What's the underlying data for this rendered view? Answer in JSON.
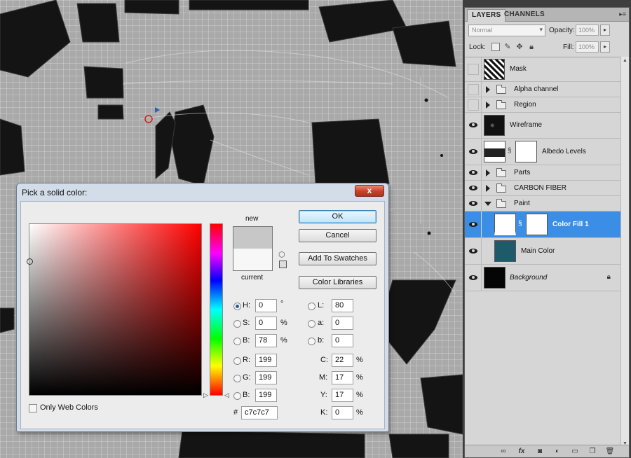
{
  "dialog": {
    "title": "Pick a solid color:",
    "close_label": "x",
    "new_label": "new",
    "current_label": "current",
    "buttons": {
      "ok": "OK",
      "cancel": "Cancel",
      "add_to_swatches": "Add To Swatches",
      "color_libraries": "Color Libraries"
    },
    "fields": {
      "H": {
        "label": "H:",
        "value": "0",
        "unit": "°"
      },
      "S": {
        "label": "S:",
        "value": "0",
        "unit": "%"
      },
      "Bri": {
        "label": "B:",
        "value": "78",
        "unit": "%"
      },
      "R": {
        "label": "R:",
        "value": "199"
      },
      "G": {
        "label": "G:",
        "value": "199"
      },
      "Blu": {
        "label": "B:",
        "value": "199"
      },
      "L": {
        "label": "L:",
        "value": "80"
      },
      "a": {
        "label": "a:",
        "value": "0"
      },
      "b": {
        "label": "b:",
        "value": "0"
      },
      "C": {
        "label": "C:",
        "value": "22",
        "unit": "%"
      },
      "M": {
        "label": "M:",
        "value": "17",
        "unit": "%"
      },
      "Y": {
        "label": "Y:",
        "value": "17",
        "unit": "%"
      },
      "K": {
        "label": "K:",
        "value": "0",
        "unit": "%"
      }
    },
    "hex": {
      "label": "#",
      "value": "c7c7c7"
    },
    "only_web_colors": "Only Web Colors",
    "new_color": "#c7c7c7",
    "current_color": "#f7f7f7"
  },
  "layers_panel": {
    "tabs": [
      "LAYERS",
      "CHANNELS"
    ],
    "blend_mode": "Normal",
    "opacity_label": "Opacity:",
    "opacity_value": "100%",
    "lock_label": "Lock:",
    "fill_label": "Fill:",
    "fill_value": "100%",
    "layers": [
      {
        "name": "Mask",
        "visible": false
      },
      {
        "name": "Alpha channel",
        "visible": false
      },
      {
        "name": "Region",
        "visible": false
      },
      {
        "name": "Wireframe",
        "visible": true
      },
      {
        "name": "Albedo Levels",
        "visible": true
      },
      {
        "name": "Parts",
        "visible": true
      },
      {
        "name": "CARBON FIBER",
        "visible": true
      },
      {
        "name": "Paint",
        "visible": true
      },
      {
        "name": "Color Fill 1",
        "visible": true,
        "selected": true
      },
      {
        "name": "Main Color",
        "visible": true
      },
      {
        "name": "Background",
        "visible": true
      }
    ],
    "main_color_swatch": "#1f5a6b"
  }
}
